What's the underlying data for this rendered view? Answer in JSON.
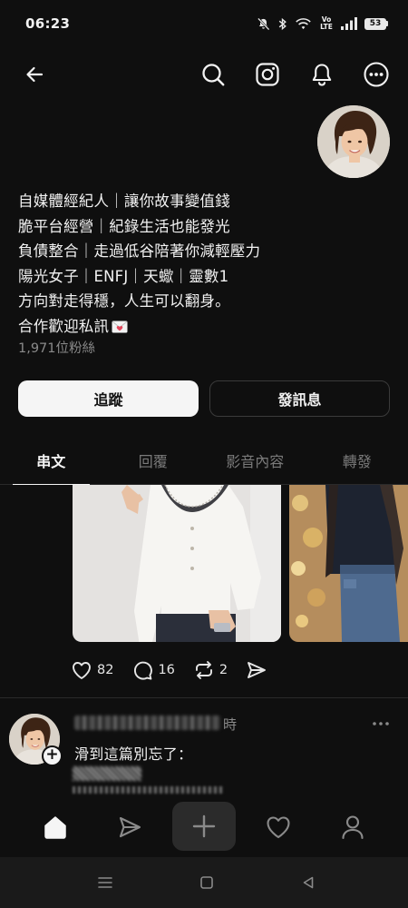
{
  "status_bar": {
    "time": "06:23",
    "network_label": "Vo LTE",
    "battery": "53"
  },
  "profile": {
    "bio_lines": [
      "自媒體經紀人｜讓你故事變值錢",
      "脆平台經營｜紀錄生活也能發光",
      "負債整合｜走過低谷陪著你減輕壓力",
      "陽光女子｜ENFJ｜天蠍｜靈數1",
      "方向對走得穩，人生可以翻身。",
      "合作歡迎私訊"
    ],
    "followers": "1,971位粉絲",
    "follow_label": "追蹤",
    "message_label": "發訊息"
  },
  "tabs": [
    "串文",
    "回覆",
    "影音內容",
    "轉發"
  ],
  "post": {
    "likes": "82",
    "comments": "16",
    "reposts": "2"
  },
  "next_post": {
    "time": "時",
    "text": "滑到這篇別忘了："
  },
  "icons": {
    "back": "back-arrow-icon",
    "search": "search-icon",
    "instagram": "instagram-icon",
    "notifications": "bell-icon",
    "more": "more-icon",
    "bio_emoji": "love-letter-icon"
  },
  "colors": {
    "background": "#0f0f0f",
    "text": "#f2f2f2",
    "muted": "#7a7a7a",
    "follow_button": "#f5f5f5"
  }
}
